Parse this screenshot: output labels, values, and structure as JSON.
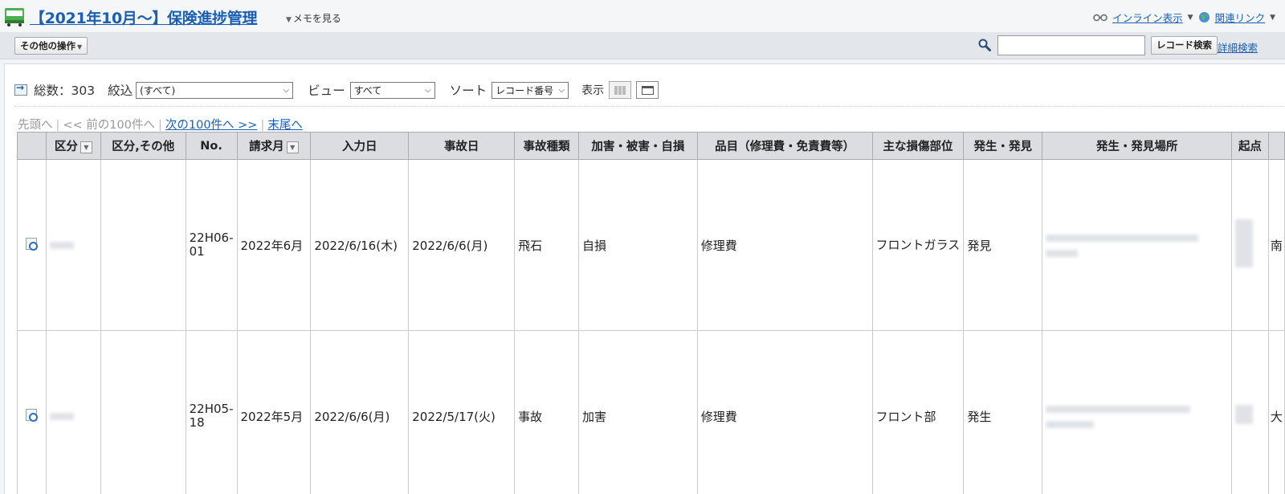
{
  "header": {
    "title": "【2021年10月～】保険進捗管理",
    "memo": "メモを見る",
    "inline_view": "インライン表示",
    "related_links": "関連リンク"
  },
  "toolbar": {
    "other_actions": "その他の操作",
    "search_placeholder": "",
    "search_button": "レコード検索",
    "advanced_search": "詳細検索"
  },
  "controls": {
    "total_label": "総数：303",
    "filter_label": "絞込",
    "filter_value": "(すべて)",
    "view_label": "ビュー",
    "view_value": "すべて",
    "sort_label": "ソート",
    "sort_value": "レコード番号",
    "display_label": "表示"
  },
  "pager": {
    "first": "先頭へ",
    "prev": "<< 前の100件へ",
    "next": "次の100件へ >>",
    "last": "末尾へ"
  },
  "table": {
    "columns": [
      "区分",
      "区分,その他",
      "No.",
      "請求月",
      "入力日",
      "事故日",
      "事故種類",
      "加害・被害・自損",
      "品目（修理費・免責費等）",
      "主な損傷部位",
      "発生・発見",
      "発生・発見場所",
      "起点"
    ],
    "rows": [
      {
        "no": "22H06-01",
        "month": "2022年6月",
        "input_date": "2022/6/16(木)",
        "accident_date": "2022/6/6(月)",
        "type": "飛石",
        "party": "自損",
        "item": "修理費",
        "part": "フロントガラス",
        "occur": "発見",
        "origin": "南"
      },
      {
        "no": "22H05-18",
        "month": "2022年5月",
        "input_date": "2022/6/6(月)",
        "accident_date": "2022/5/17(火)",
        "type": "事故",
        "party": "加害",
        "item": "修理費",
        "part": "フロント部",
        "occur": "発生",
        "origin": "大"
      }
    ]
  }
}
